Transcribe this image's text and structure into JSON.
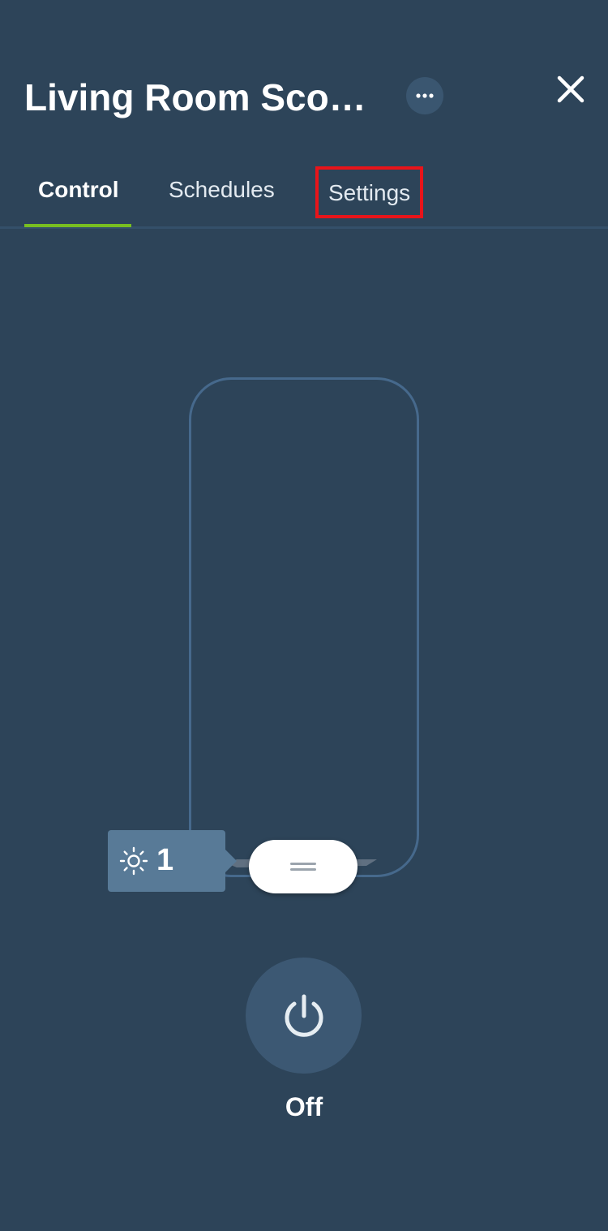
{
  "header": {
    "title": "Living Room Sco…",
    "more_icon": "more-horizontal-icon",
    "close_icon": "close-icon"
  },
  "tabs": [
    {
      "label": "Control",
      "selected": true
    },
    {
      "label": "Schedules",
      "selected": false
    },
    {
      "label": "Settings",
      "selected": false,
      "highlighted": true
    }
  ],
  "slider": {
    "level_value": "1",
    "level_icon": "brightness-sun-icon",
    "level_fraction": 0.0
  },
  "power": {
    "icon": "power-icon",
    "state_label": "Off"
  },
  "colors": {
    "background": "#2d4459",
    "tab_indicator": "#78be20",
    "highlight_box": "#e8141a",
    "level_badge": "#587a97",
    "track_border": "#46698c"
  }
}
